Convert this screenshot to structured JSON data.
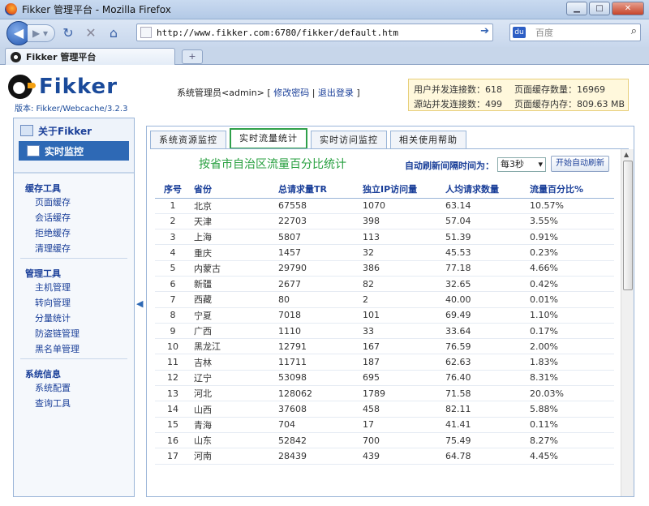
{
  "browser": {
    "window_title": "Fikker 管理平台 - Mozilla Firefox",
    "url": "http://www.fikker.com:6780/fikker/default.htm",
    "search_placeholder": "百度",
    "tab_title": "Fikker 管理平台"
  },
  "header": {
    "logo_text": "Fikker",
    "version": "版本: Fikker/Webcache/3.2.3",
    "user": "系统管理员<admin>",
    "change_password": "修改密码",
    "logout": "退出登录",
    "stats": {
      "user_conn": "用户并发连接数：618",
      "origin_conn": "源站并发连接数：499",
      "cache_count": "页面缓存数量：16969",
      "cache_mem": "页面缓存内存：809.63 MB"
    }
  },
  "sidebar": {
    "about": "关于Fikker",
    "realtime": "实时监控",
    "sections": [
      {
        "title": "缓存工具",
        "items": [
          "页面缓存",
          "会话缓存",
          "拒绝缓存",
          "清理缓存"
        ]
      },
      {
        "title": "管理工具",
        "items": [
          "主机管理",
          "转向管理",
          "分量统计",
          "防盗链管理",
          "黑名单管理"
        ]
      },
      {
        "title": "系统信息",
        "items": [
          "系统配置",
          "查询工具"
        ]
      }
    ]
  },
  "main": {
    "tabs": [
      "系统资源监控",
      "实时流量统计",
      "实时访问监控",
      "相关使用帮助"
    ],
    "heading": "按省市自治区流量百分比统计",
    "refresh_label": "自动刷新间隔时间为：",
    "refresh_value": "每3秒",
    "refresh_button": "开始自动刷新",
    "columns": [
      "序号",
      "省份",
      "总请求量TR",
      "独立IP访问量",
      "人均请求数量",
      "流量百分比%"
    ],
    "rows": [
      [
        "1",
        "北京",
        "67558",
        "1070",
        "63.14",
        "10.57%"
      ],
      [
        "2",
        "天津",
        "22703",
        "398",
        "57.04",
        "3.55%"
      ],
      [
        "3",
        "上海",
        "5807",
        "113",
        "51.39",
        "0.91%"
      ],
      [
        "4",
        "重庆",
        "1457",
        "32",
        "45.53",
        "0.23%"
      ],
      [
        "5",
        "内蒙古",
        "29790",
        "386",
        "77.18",
        "4.66%"
      ],
      [
        "6",
        "新疆",
        "2677",
        "82",
        "32.65",
        "0.42%"
      ],
      [
        "7",
        "西藏",
        "80",
        "2",
        "40.00",
        "0.01%"
      ],
      [
        "8",
        "宁夏",
        "7018",
        "101",
        "69.49",
        "1.10%"
      ],
      [
        "9",
        "广西",
        "1110",
        "33",
        "33.64",
        "0.17%"
      ],
      [
        "10",
        "黑龙江",
        "12791",
        "167",
        "76.59",
        "2.00%"
      ],
      [
        "11",
        "吉林",
        "11711",
        "187",
        "62.63",
        "1.83%"
      ],
      [
        "12",
        "辽宁",
        "53098",
        "695",
        "76.40",
        "8.31%"
      ],
      [
        "13",
        "河北",
        "128062",
        "1789",
        "71.58",
        "20.03%"
      ],
      [
        "14",
        "山西",
        "37608",
        "458",
        "82.11",
        "5.88%"
      ],
      [
        "15",
        "青海",
        "704",
        "17",
        "41.41",
        "0.11%"
      ],
      [
        "16",
        "山东",
        "52842",
        "700",
        "75.49",
        "8.27%"
      ],
      [
        "17",
        "河南",
        "28439",
        "439",
        "64.78",
        "4.45%"
      ]
    ]
  }
}
